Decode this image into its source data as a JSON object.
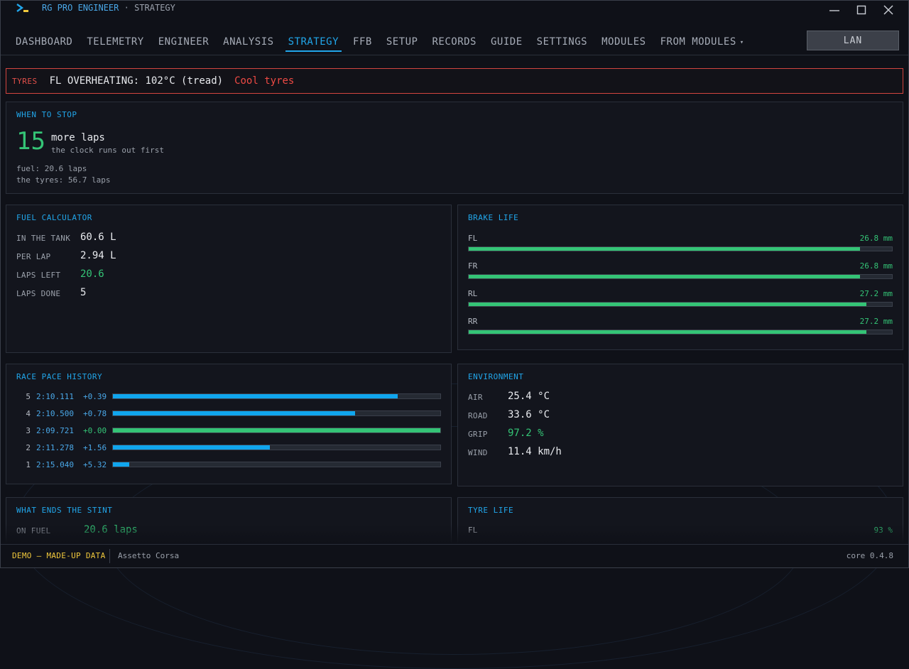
{
  "app": {
    "name": "RG PRO ENGINEER",
    "separator": "·",
    "section": "STRATEGY",
    "colors": {
      "accent": "#21a6ea",
      "good": "#34c476",
      "alert": "#e2504a",
      "demo": "#f0c83c"
    }
  },
  "nav": {
    "tabs": [
      {
        "label": "DASHBOARD"
      },
      {
        "label": "TELEMETRY"
      },
      {
        "label": "ENGINEER"
      },
      {
        "label": "ANALYSIS"
      },
      {
        "label": "STRATEGY",
        "active": true
      },
      {
        "label": "FFB"
      },
      {
        "label": "SETUP"
      },
      {
        "label": "RECORDS"
      },
      {
        "label": "GUIDE"
      },
      {
        "label": "SETTINGS"
      },
      {
        "label": "MODULES"
      },
      {
        "label": "FROM MODULES",
        "caret": "▾"
      }
    ],
    "lan_label": "LAN"
  },
  "alert": {
    "tag": "TYRES",
    "message": "FL OVERHEATING: 102°C (tread)",
    "action": "Cool tyres"
  },
  "when_to_stop": {
    "title": "WHEN TO STOP",
    "laps": "15",
    "label": "more laps",
    "reason": "the clock runs out first",
    "fuel_line": "fuel: 20.6 laps",
    "tyres_line": "the tyres: 56.7 laps"
  },
  "fuel": {
    "title": "FUEL CALCULATOR",
    "rows": [
      {
        "label": "IN THE TANK",
        "value": "60.6 L"
      },
      {
        "label": "PER LAP",
        "value": "2.94 L"
      },
      {
        "label": "LAPS LEFT",
        "value": "20.6"
      },
      {
        "label": "LAPS DONE",
        "value": "5"
      }
    ]
  },
  "brake": {
    "title": "BRAKE LIFE",
    "rows": [
      {
        "label": "FL",
        "value": "26.8 mm",
        "fraction": 0.925
      },
      {
        "label": "FR",
        "value": "26.8 mm",
        "fraction": 0.925
      },
      {
        "label": "RL",
        "value": "27.2 mm",
        "fraction": 0.94
      },
      {
        "label": "RR",
        "value": "27.2 mm",
        "fraction": 0.94
      }
    ]
  },
  "pace": {
    "title": "RACE PACE HISTORY",
    "rows": [
      {
        "lap": "5",
        "time": "2:10.111",
        "delta": "+0.39",
        "fraction": 0.87
      },
      {
        "lap": "4",
        "time": "2:10.500",
        "delta": "+0.78",
        "fraction": 0.74
      },
      {
        "lap": "3",
        "time": "2:09.721",
        "delta": "+0.00",
        "fraction": 1.0,
        "best": true
      },
      {
        "lap": "2",
        "time": "2:11.278",
        "delta": "+1.56",
        "fraction": 0.48
      },
      {
        "lap": "1",
        "time": "2:15.040",
        "delta": "+5.32",
        "fraction": 0.05
      }
    ]
  },
  "environment": {
    "title": "ENVIRONMENT",
    "rows": [
      {
        "label": "AIR",
        "value": "25.4 °C"
      },
      {
        "label": "ROAD",
        "value": "33.6 °C"
      },
      {
        "label": "GRIP",
        "value": "97.2 %"
      },
      {
        "label": "WIND",
        "value": "11.4 km/h"
      }
    ]
  },
  "stint": {
    "title": "WHAT ENDS THE STINT",
    "row_label": "ON FUEL",
    "row_value": "20.6 laps"
  },
  "tyre_life": {
    "title": "TYRE LIFE",
    "row_label": "FL",
    "row_value": "93 %"
  },
  "status": {
    "demo": "DEMO — MADE-UP DATA",
    "game": "Assetto Corsa",
    "version": "core 0.4.8"
  }
}
